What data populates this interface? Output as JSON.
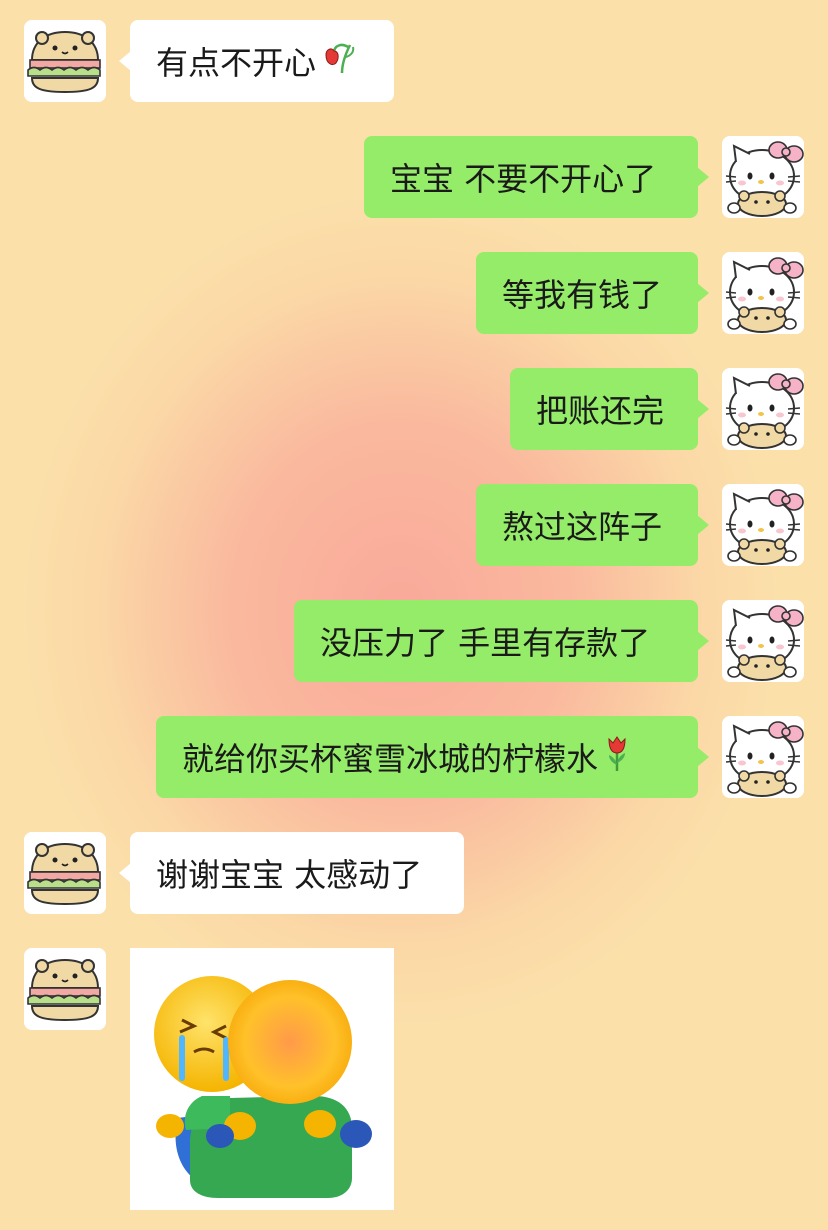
{
  "messages": [
    {
      "side": "in",
      "text": "有点不开心",
      "emoji": "wilted-flower"
    },
    {
      "side": "out",
      "text": "宝宝 不要不开心了"
    },
    {
      "side": "out",
      "text": "等我有钱了"
    },
    {
      "side": "out",
      "text": "把账还完"
    },
    {
      "side": "out",
      "text": "熬过这阵子"
    },
    {
      "side": "out",
      "text": "没压力了 手里有存款了"
    },
    {
      "side": "out",
      "text": "就给你买杯蜜雪冰城的柠檬水",
      "emoji": "tulip"
    },
    {
      "side": "in",
      "text": "谢谢宝宝 太感动了"
    },
    {
      "side": "in",
      "type": "sticker",
      "sticker": "hug-emoji-sticker"
    }
  ],
  "colors": {
    "incoming_bubble": "#ffffff",
    "outgoing_bubble": "#95ec69",
    "background_edge": "#fbe0aa",
    "background_center": "#f9a99a"
  },
  "icons": {
    "incoming_avatar": "sandwich-bear-avatar",
    "outgoing_avatar": "hello-kitty-avatar"
  }
}
